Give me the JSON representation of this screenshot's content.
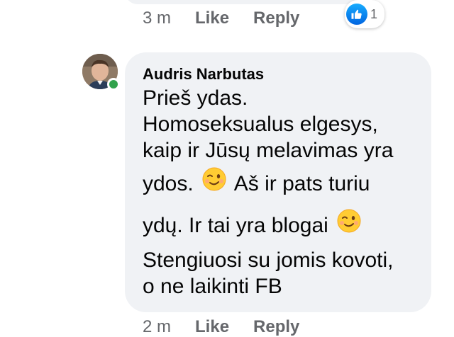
{
  "previous_comment": {
    "time": "3 m",
    "like_label": "Like",
    "reply_label": "Reply",
    "reaction": {
      "icon": "like-icon",
      "count": "1"
    }
  },
  "comment": {
    "author": "Audris Narbutas",
    "online": true,
    "lines": [
      "Prieš ydas.",
      "Homoseksualus elgesys,",
      "kaip ir Jūsų melavimas yra",
      "ydos.",
      "Aš ir pats turiu",
      "ydų. Ir tai yra blogai",
      "Stengiuosi su jomis kovoti,",
      "o ne laikinti FB"
    ],
    "emoji": "winking-face-emoji",
    "time": "2 m",
    "like_label": "Like",
    "reply_label": "Reply"
  },
  "colors": {
    "bubble_bg": "#f0f2f5",
    "meta_text": "#65676b",
    "like_blue": "#0165e1",
    "online_green": "#31a24c"
  }
}
